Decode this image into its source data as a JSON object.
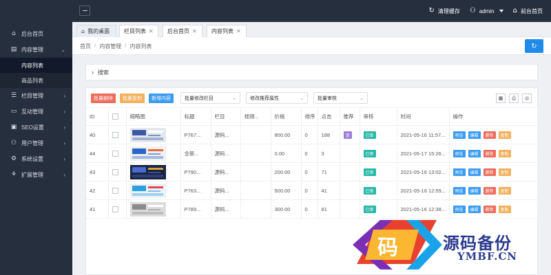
{
  "topbar": {
    "clear_cache": "清理缓存",
    "user": "admin",
    "frontend_home": "前台首页",
    "icons": [
      "menu-icon",
      "refresh-icon",
      "user-icon",
      "home-icon"
    ]
  },
  "sidebar": {
    "items": [
      {
        "label": "后台首页",
        "icon": "home-icon"
      },
      {
        "label": "内容管理",
        "icon": "content-icon",
        "expanded": true,
        "children": [
          {
            "label": "内容列表",
            "active": true
          },
          {
            "label": "商品列表",
            "active": false
          }
        ]
      },
      {
        "label": "栏目管理",
        "icon": "column-icon"
      },
      {
        "label": "互动管理",
        "icon": "chat-icon"
      },
      {
        "label": "SEO设置",
        "icon": "seo-icon"
      },
      {
        "label": "用户管理",
        "icon": "user-icon"
      },
      {
        "label": "系统设置",
        "icon": "gear-icon"
      },
      {
        "label": "扩展管理",
        "icon": "extension-icon"
      }
    ]
  },
  "tabs": [
    {
      "label": "我的桌面",
      "closable": false
    },
    {
      "label": "栏目列表",
      "closable": true
    },
    {
      "label": "后台首页",
      "closable": true
    },
    {
      "label": "内容列表",
      "closable": true
    }
  ],
  "breadcrumb": [
    "首页",
    "内容管理",
    "内容列表"
  ],
  "search": {
    "label": "搜索"
  },
  "toolbar": {
    "batch_delete": "批量删除",
    "batch_copy": "批量复制",
    "add_content": "新增内容",
    "select_column": "批量修改栏目",
    "select_attr": "修改推荐属性",
    "select_audit": "批量审核"
  },
  "table": {
    "headers": [
      "ID",
      "",
      "缩略图",
      "标题",
      "栏目",
      "视频...",
      "价格",
      "排序",
      "点击",
      "推荐",
      "审核",
      "时间",
      "操作"
    ],
    "rows": [
      {
        "id": "40",
        "title": "P767...",
        "column": "源码...",
        "video": "",
        "price": "800.00",
        "sort": "0",
        "clicks": "188",
        "recommend": "顶",
        "audit": "已审",
        "time": "2021-05-16 11:57..."
      },
      {
        "id": "44",
        "title": "全新...",
        "column": "源码...",
        "video": "",
        "price": "0.00",
        "sort": "0",
        "clicks": "3",
        "recommend": "",
        "audit": "已审",
        "time": "2021-05-17 15:26..."
      },
      {
        "id": "43",
        "title": "P790...",
        "column": "源码...",
        "video": "",
        "price": "200.00",
        "sort": "0",
        "clicks": "71",
        "recommend": "",
        "audit": "已审",
        "time": "2021-05-16 13:02..."
      },
      {
        "id": "42",
        "title": "P763...",
        "column": "源码...",
        "video": "",
        "price": "500.00",
        "sort": "0",
        "clicks": "41",
        "recommend": "",
        "audit": "已审",
        "time": "2021-05-16 12:59..."
      },
      {
        "id": "41",
        "title": "P789...",
        "column": "源码...",
        "video": "",
        "price": "300.00",
        "sort": "0",
        "clicks": "81",
        "recommend": "",
        "audit": "已审",
        "time": "2021-05-16 12:38..."
      }
    ],
    "ops": [
      "预览",
      "编辑",
      "删除",
      "复制"
    ]
  },
  "watermark": {
    "glyph": "码",
    "title": "源码备份",
    "sub": "YMBF.CN"
  },
  "colors": {
    "sidebar_bg": "#262f3e",
    "primary": "#1f8ceb",
    "danger": "#ee6a5a",
    "warn": "#f3b05d",
    "success": "#27b8a7"
  }
}
